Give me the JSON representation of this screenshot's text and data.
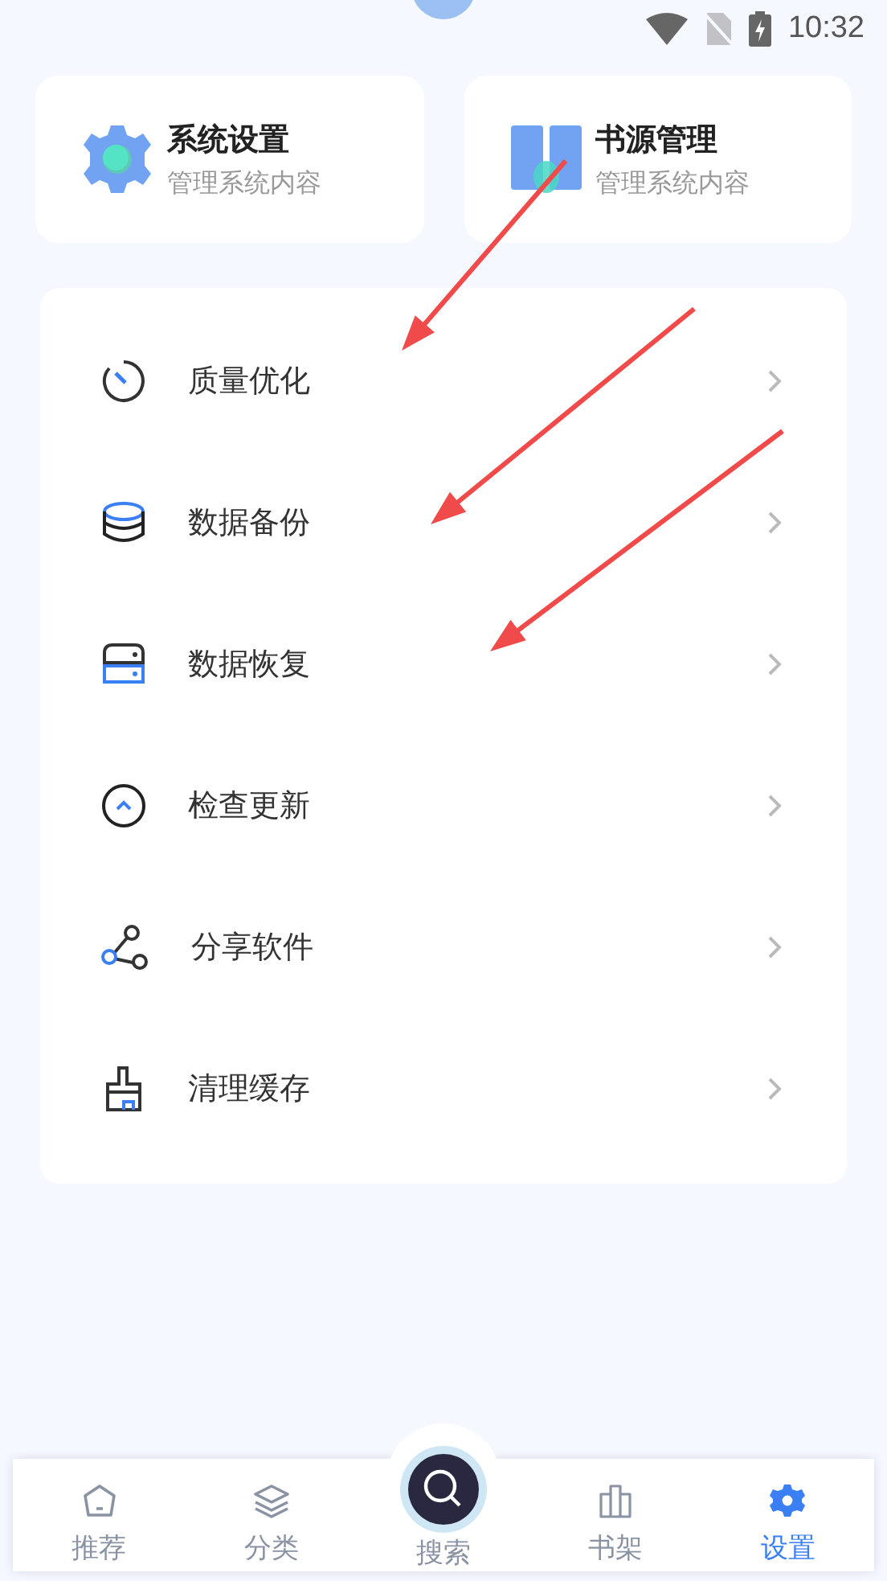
{
  "status_bar": {
    "time": "10:32"
  },
  "cards": [
    {
      "kind": "gear",
      "title": "系统设置",
      "subtitle": "管理系统内容"
    },
    {
      "kind": "book",
      "title": "书源管理",
      "subtitle": "管理系统内容"
    }
  ],
  "menu": [
    {
      "kind": "timer",
      "label": "质量优化",
      "arrow": true
    },
    {
      "kind": "database",
      "label": "数据备份",
      "arrow": true
    },
    {
      "kind": "drive",
      "label": "数据恢复",
      "arrow": true
    },
    {
      "kind": "update",
      "label": "检查更新",
      "arrow": false
    },
    {
      "kind": "share",
      "label": "分享软件",
      "arrow": false
    },
    {
      "kind": "brush",
      "label": "清理缓存",
      "arrow": false
    }
  ],
  "tabs": [
    {
      "kind": "home",
      "label": "推荐",
      "selected": false
    },
    {
      "kind": "layers",
      "label": "分类",
      "selected": false
    },
    {
      "kind": "search",
      "label": "搜索",
      "selected": false
    },
    {
      "kind": "shelf",
      "label": "书架",
      "selected": false
    },
    {
      "kind": "settings",
      "label": "设置",
      "selected": true
    }
  ]
}
